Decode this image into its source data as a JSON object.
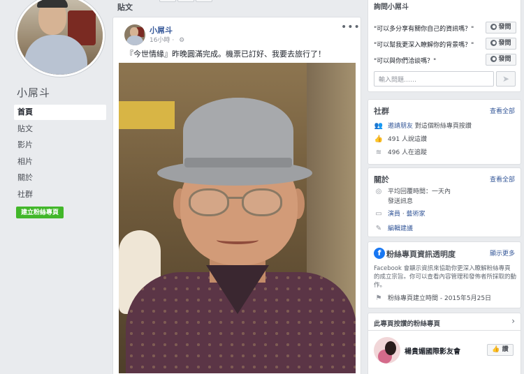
{
  "page": {
    "name": "小屌斗",
    "create_button": "建立粉絲專頁"
  },
  "nav": {
    "items": [
      {
        "label": "首頁",
        "active": true
      },
      {
        "label": "貼文"
      },
      {
        "label": "影片"
      },
      {
        "label": "相片"
      },
      {
        "label": "關於"
      },
      {
        "label": "社群"
      }
    ]
  },
  "feed": {
    "section_title": "貼文"
  },
  "post": {
    "author": "小屌斗",
    "time": "16小時",
    "text": "『今世情緣』昨晚圓滿完成。機票已訂好、我要去旅行了！",
    "more": "•••"
  },
  "ask": {
    "header": "詢問小屌斗",
    "questions": [
      {
        "text": "\"可以多分享有關你自己的資訊嗎？\"",
        "button": "發問"
      },
      {
        "text": "\"可以幫我更深入瞭解你的背景嗎？\"",
        "button": "發問"
      },
      {
        "text": "\"可以與你們洽談嗎？\"",
        "button": "發問"
      }
    ],
    "input_placeholder": "輸入問題……"
  },
  "community": {
    "title": "社群",
    "see_all": "查看全部",
    "invite_link": "邀請朋友",
    "invite_text": "對這個粉絲專頁按讚",
    "likes": "491 人說這讚",
    "follows": "496 人在追蹤"
  },
  "about": {
    "title": "關於",
    "see_all": "查看全部",
    "response": "平均回覆時間：一天內",
    "send_message": "發送訊息",
    "category_1": "演員",
    "category_sep": "·",
    "category_2": "藝術家",
    "suggest_edit": "編輯建議"
  },
  "transparency": {
    "title": "粉絲專頁資訊透明度",
    "see_more": "顯示更多",
    "description": "Facebook 會顯示資訊來協助你更深入瞭解粉絲專頁的成立宗旨。你可以查看內容管理和發佈者所採取的動作。",
    "created": "粉絲專頁建立時間 - 2015年5月25日"
  },
  "liked_pages": {
    "title": "此專頁按讚的粉絲專頁",
    "page_name": "楊貴媚國際影友會",
    "like_button": "讚"
  },
  "colors": {
    "facebook_blue": "#4267b2",
    "link_blue": "#365899",
    "create_green": "#42b72a",
    "background": "#e9ebee"
  }
}
